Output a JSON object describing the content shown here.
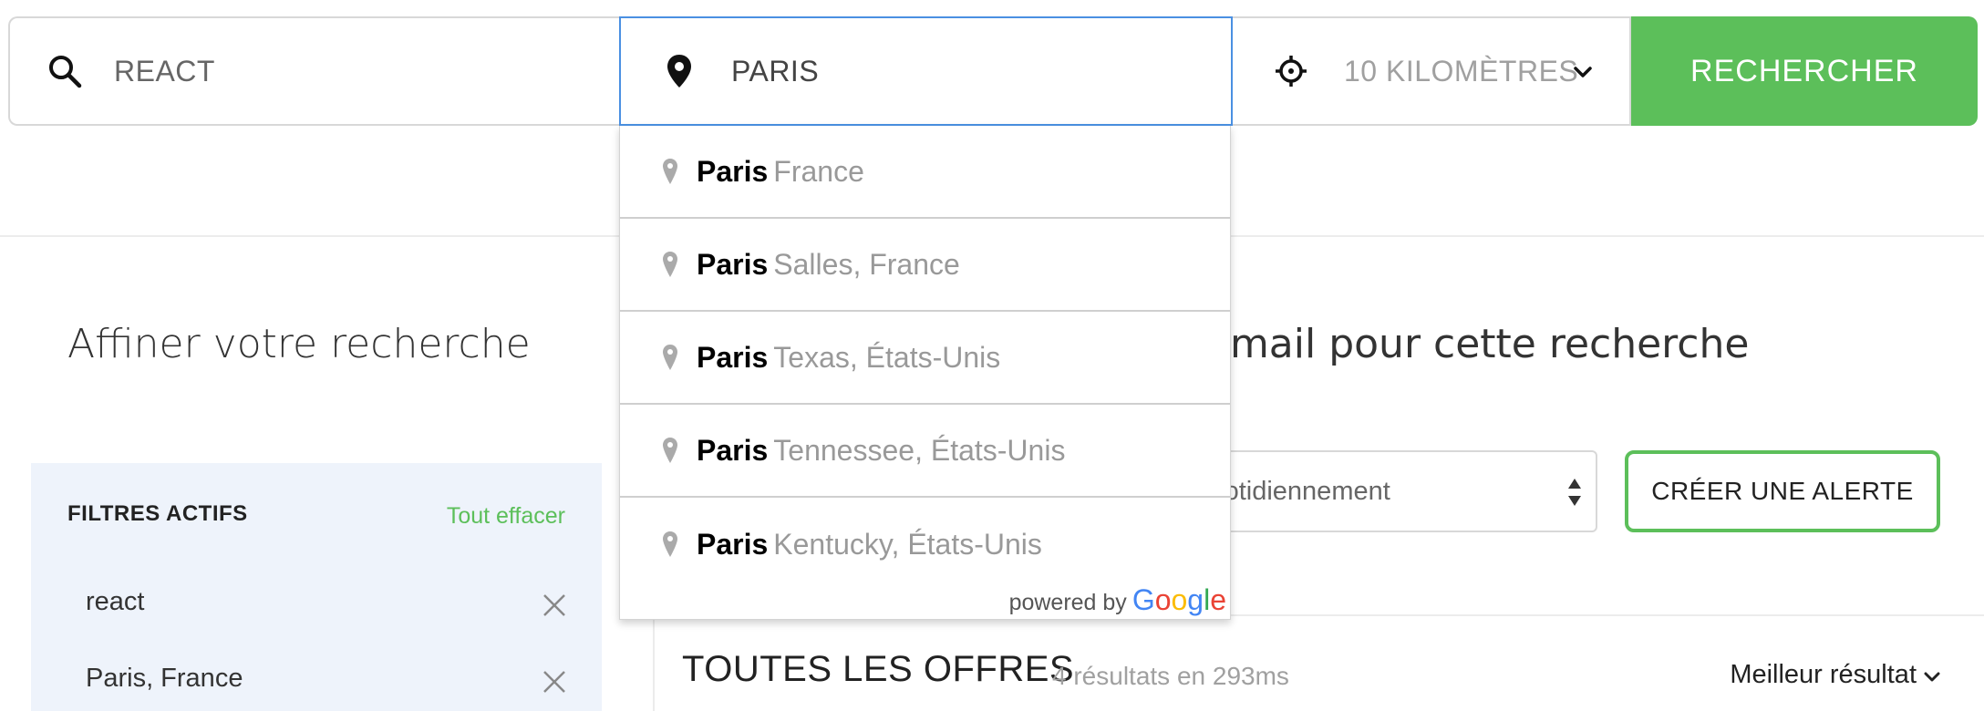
{
  "search": {
    "keyword_value": "REACT",
    "location_value": "PARIS",
    "radius_value": "10 KILOMÈTRES",
    "submit_label": "RECHERCHER"
  },
  "autocomplete": {
    "suggestions": [
      {
        "main": "Paris",
        "secondary": "France"
      },
      {
        "main": "Paris",
        "secondary": "Salles, France"
      },
      {
        "main": "Paris",
        "secondary": "Texas, États-Unis"
      },
      {
        "main": "Paris",
        "secondary": "Tennessee, États-Unis"
      },
      {
        "main": "Paris",
        "secondary": "Kentucky, États-Unis"
      }
    ],
    "powered_by": "powered by",
    "google_letters": [
      "G",
      "o",
      "o",
      "g",
      "l",
      "e"
    ]
  },
  "refine": {
    "title": "Affiner votre recherche"
  },
  "filters": {
    "heading": "FILTRES ACTIFS",
    "clear_all": "Tout effacer",
    "chips": [
      "react",
      "Paris, France"
    ]
  },
  "alert": {
    "title_visible": "e-mail pour cette recherche",
    "frequency_visible": "yer quotidiennement",
    "create_label": "CRÉER UNE ALERTE"
  },
  "results": {
    "title": "TOUTES LES OFFRES",
    "meta": "4 résultats en 293ms",
    "sort_label": "Meilleur résultat"
  },
  "colors": {
    "accent_green": "#5cbf5a",
    "focus_blue": "#4a90e2",
    "filters_bg": "#eef3fb",
    "google_blue": "#4285F4",
    "google_red": "#EA4335",
    "google_yellow": "#FBBC05",
    "google_green": "#34A853"
  },
  "icons": {
    "keyword": "search-icon",
    "location": "location-pin-icon",
    "radius": "crosshair-icon",
    "radius_toggle": "chevron-down-icon",
    "suggestion": "map-pin-icon",
    "remove_filter": "close-icon",
    "select_arrows": "updown-arrows-icon",
    "sort": "chevron-down-icon"
  }
}
